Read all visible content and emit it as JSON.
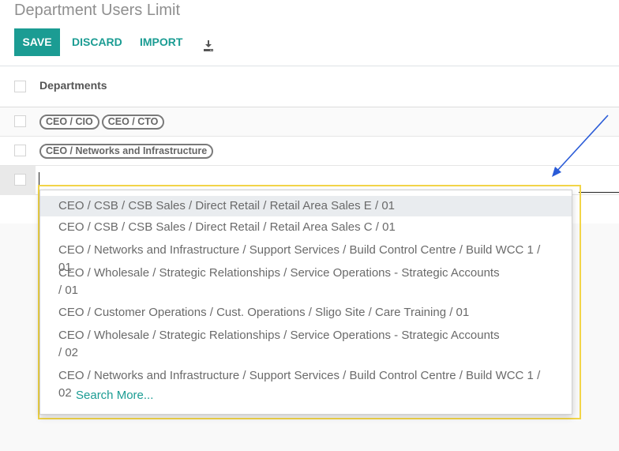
{
  "header": {
    "title": "Department Users Limit",
    "save_label": "SAVE",
    "discard_label": "DISCARD",
    "import_label": "IMPORT",
    "download_icon": "download-icon"
  },
  "colors": {
    "accent": "#1b9c93",
    "highlight_box": "#f2d548",
    "annotation_arrow": "#2a5bd7"
  },
  "list": {
    "column_header": "Departments",
    "rows": [
      {
        "tags": [
          "CEO / CIO",
          "CEO / CTO"
        ]
      },
      {
        "tags": [
          "CEO / Networks and Infrastructure"
        ]
      },
      {
        "tags": [],
        "editing": true,
        "input_value": ""
      }
    ]
  },
  "dropdown": {
    "options": [
      "CEO / CSB / CSB Sales / Direct Retail / Retail Area Sales E / 01",
      "CEO / CSB / CSB Sales / Direct Retail / Retail Area Sales C / 01",
      "CEO / Networks and Infrastructure / Support Services / Build Control Centre / Build WCC 1 / 01",
      "CEO / Wholesale / Strategic Relationships / Service Operations - Strategic Accounts / 01",
      "CEO / Customer Operations / Cust. Operations / Sligo Site / Care Training / 01",
      "CEO / Wholesale / Strategic Relationships / Service Operations - Strategic Accounts / 02",
      "CEO / Networks and Infrastructure / Support Services / Build Control Centre / Build WCC 1 / 02"
    ],
    "active_index": 0,
    "search_more_label": "Search More..."
  }
}
